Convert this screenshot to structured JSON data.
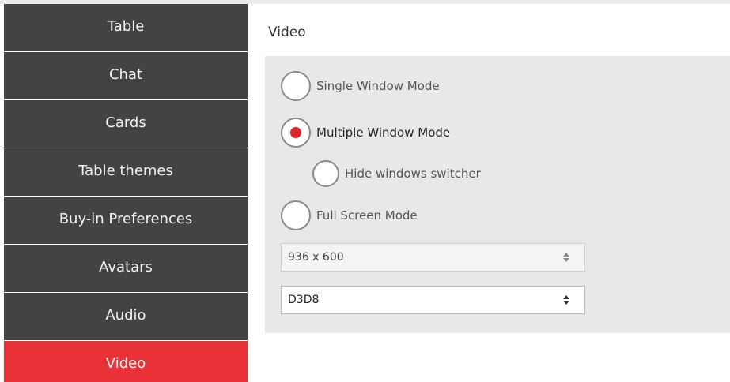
{
  "sidebar": {
    "items": [
      {
        "label": "Table"
      },
      {
        "label": "Chat"
      },
      {
        "label": "Cards"
      },
      {
        "label": "Table themes"
      },
      {
        "label": "Buy-in Preferences"
      },
      {
        "label": "Avatars"
      },
      {
        "label": "Audio"
      },
      {
        "label": "Video"
      }
    ],
    "active": "Video"
  },
  "panel": {
    "title": "Video",
    "options": {
      "single_window": {
        "label": "Single Window Mode",
        "selected": false
      },
      "multiple_window": {
        "label": "Multiple Window Mode",
        "selected": true
      },
      "hide_switcher": {
        "label": "Hide windows switcher",
        "selected": false
      },
      "full_screen": {
        "label": "Full Screen Mode",
        "selected": false
      }
    },
    "resolution": {
      "value": "936 x 600"
    },
    "renderer": {
      "value": "D3D8"
    }
  },
  "colors": {
    "sidebar_bg": "#434343",
    "active_bg": "#e83237",
    "radio_dot": "#e0242d",
    "panel_bg": "#e8e8e8"
  }
}
